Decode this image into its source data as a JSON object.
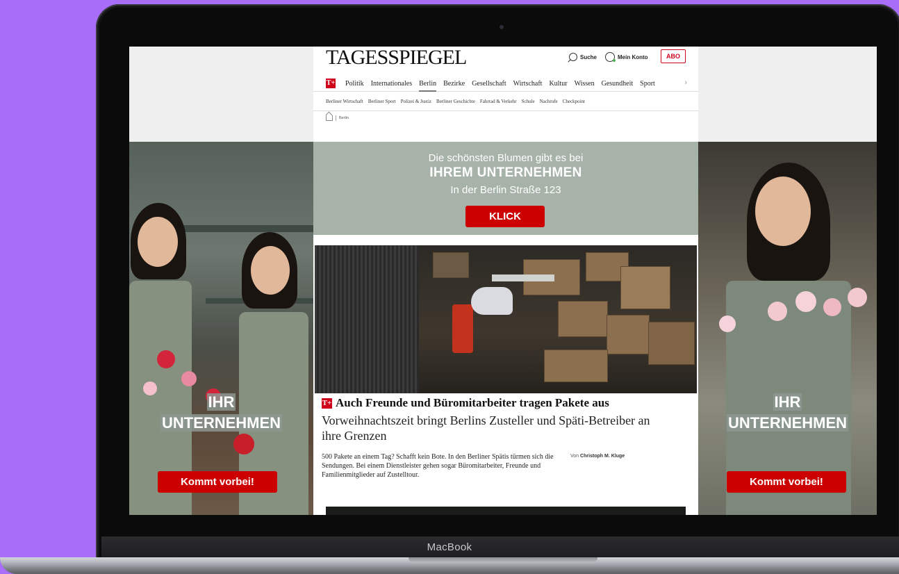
{
  "device": {
    "brand_label": "MacBook"
  },
  "site": {
    "logo": "TAGESSPIEGEL",
    "search_label": "Suche",
    "account_label": "Mein Konto",
    "abo_label": "ABO",
    "plus_badge": "T+"
  },
  "nav_primary": [
    "Politik",
    "Internationales",
    "Berlin",
    "Bezirke",
    "Gesellschaft",
    "Wirtschaft",
    "Kultur",
    "Wissen",
    "Gesundheit",
    "Sport"
  ],
  "nav_primary_active": "Berlin",
  "nav_secondary": [
    "Berliner Wirtschaft",
    "Berliner Sport",
    "Polizei & Justiz",
    "Berliner Geschichte",
    "Fahrrad & Verkehr",
    "Schule",
    "Nachrufe",
    "Checkpoint"
  ],
  "breadcrumb": {
    "current": "Berlin"
  },
  "ad_top": {
    "line1": "Die schönsten Blumen gibt es bei",
    "line2": "IHREM UNTERNEHMEN",
    "line3": "In der Berlin Straße 123",
    "button": "KLICK",
    "background_color": "#a7b3a8",
    "button_color": "#cc0000"
  },
  "article": {
    "headline": "Auch Freunde und Büromitarbeiter tragen Pakete aus",
    "subline": "Vorweihnachtszeit bringt Berlins Zusteller und Späti-Betreiber an ihre Grenzen",
    "teaser": "500 Pakete an einem Tag? Schafft kein Bote. In den Berliner Spätis türmen sich die Sendungen. Bei einem Dienstleister gehen sogar Büromitarbeiter, Freunde und Familienmitglieder auf Zustelltour.",
    "author_prefix": "Von",
    "author": "Christoph M. Kluge"
  },
  "side_ad_left": {
    "line1": "IHR",
    "line2": "UNTERNEHMEN",
    "button": "Kommt vorbei!"
  },
  "side_ad_right": {
    "line1": "IHR",
    "line2": "UNTERNEHMEN",
    "button": "Kommt vorbei!"
  },
  "colors": {
    "background": "#a96ef9",
    "brand_red": "#d0021b"
  }
}
